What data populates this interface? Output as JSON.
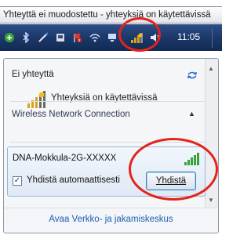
{
  "taskbar": {
    "tooltip_text": "Yhteyttä ei muodostettu - yhteyksiä on käytettävissä",
    "clock": "11:05",
    "tray_icons": [
      "network-status-icon",
      "bluetooth-icon",
      "pen-icon",
      "device-icon",
      "flag-icon",
      "wifi-icon",
      "pc-icon",
      "wireless-signal-icon",
      "speaker-icon"
    ]
  },
  "panel": {
    "status_heading": "Ei yhteyttä",
    "status_text": "Yhteyksiä on käytettävissä",
    "section_header": "Wireless Network Connection",
    "network": {
      "name": "DNA-Mokkula-2G-XXXXX",
      "auto_connect_label": "Yhdistä automaattisesti",
      "auto_connect_checked": true,
      "connect_button": "Yhdistä"
    },
    "footer_link": "Avaa Verkko- ja jakamiskeskus"
  },
  "colors": {
    "taskbar": "#1d3a6c",
    "highlight_circle": "#e3231c",
    "link": "#1a5fb4",
    "signal_green": "#3aa23a"
  }
}
